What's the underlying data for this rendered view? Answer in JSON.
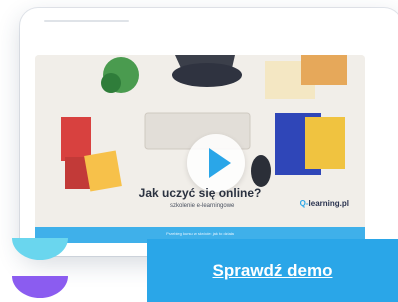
{
  "video": {
    "headline": "Jak uczyć się online?",
    "subline": "szkolenie e-learningowe",
    "brand_prefix": "Q-",
    "brand_suffix": "learning.pl",
    "bar_text": "Przebieg kursu w skrócie: jak to działa"
  },
  "cta": {
    "label": "Sprawdź demo"
  },
  "colors": {
    "accent": "#2aa6e8",
    "deco_top": "#6ad6ee",
    "deco_bottom": "#8b5cf0"
  },
  "icons": {
    "play": "play-icon",
    "deco": "brand-shape-icon"
  }
}
